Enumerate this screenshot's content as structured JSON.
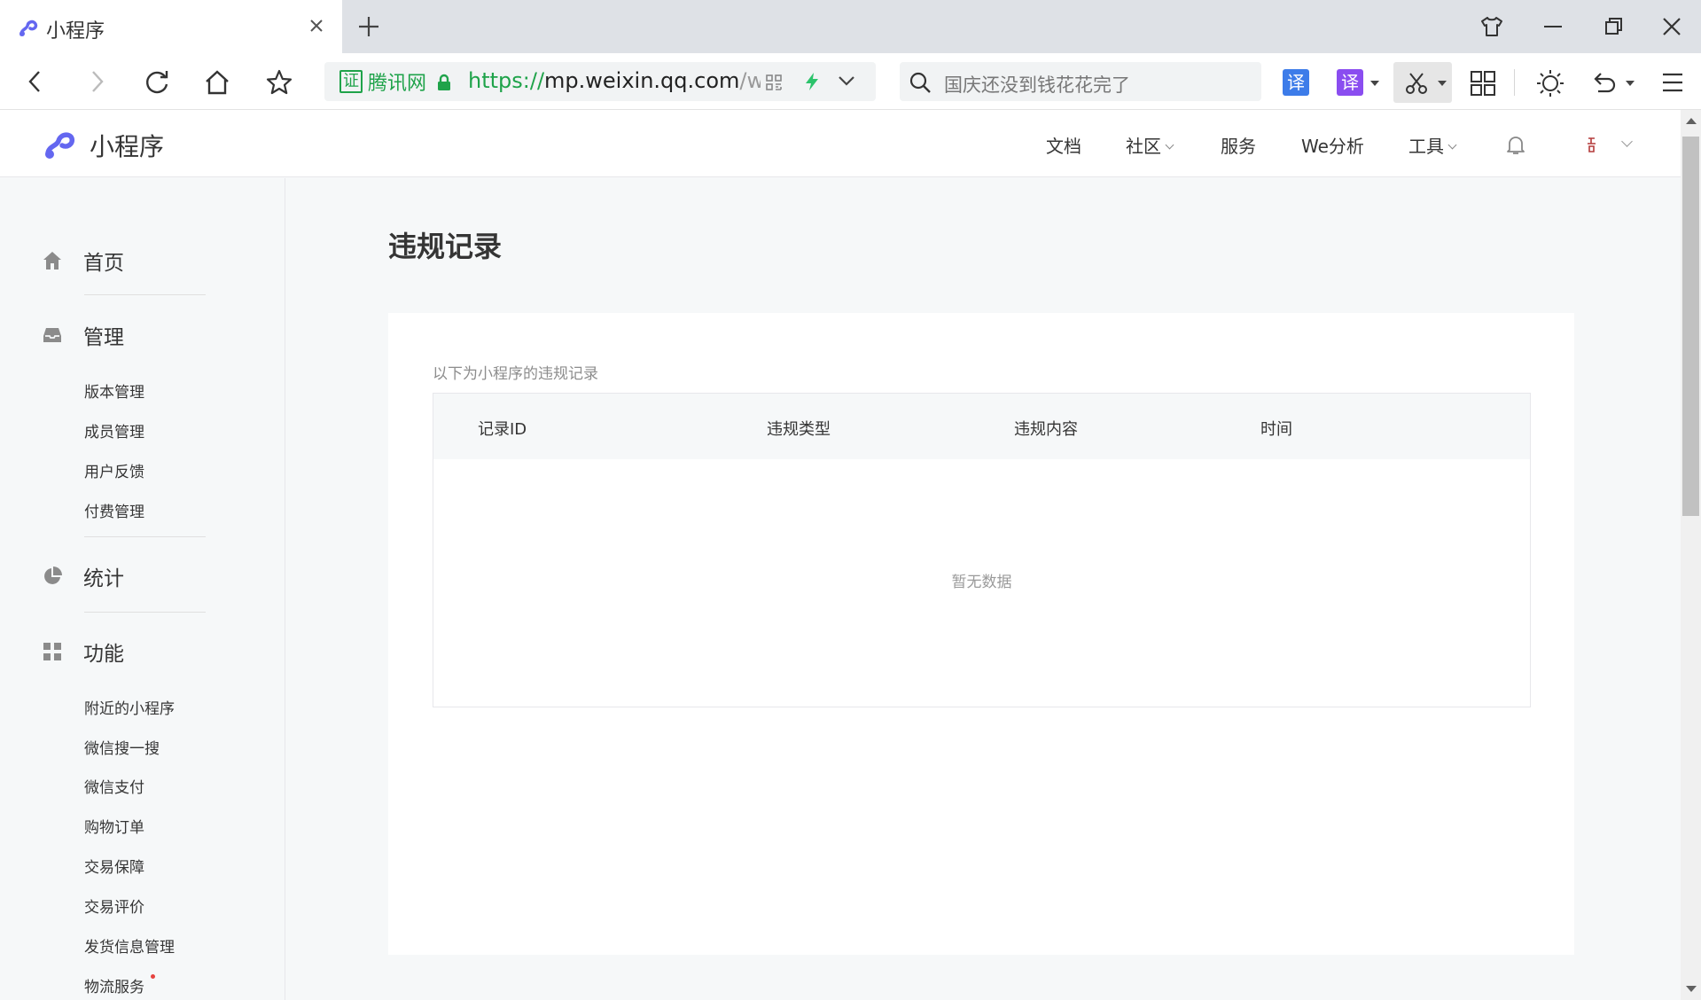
{
  "browser": {
    "tab_title": "小程序",
    "cert_badge": "证",
    "cert_label": "腾讯网",
    "url_protocol": "https://",
    "url_host": "mp.weixin.qq.com",
    "url_path": "/w:",
    "search_text": "国庆还没到钱花花完了",
    "translate_1": "译",
    "translate_2": "译"
  },
  "header": {
    "brand": "小程序",
    "nav": [
      {
        "label": "文档"
      },
      {
        "label": "社区"
      },
      {
        "label": "服务"
      },
      {
        "label": "We分析"
      },
      {
        "label": "工具"
      }
    ]
  },
  "sidebar": {
    "groups": [
      {
        "label": "首页",
        "icon": "home-icon"
      },
      {
        "label": "管理",
        "icon": "inbox-icon",
        "items": [
          "版本管理",
          "成员管理",
          "用户反馈",
          "付费管理"
        ]
      },
      {
        "label": "统计",
        "icon": "pie-chart-icon"
      },
      {
        "label": "功能",
        "icon": "grid-icon",
        "items": [
          "附近的小程序",
          "微信搜一搜",
          "微信支付",
          "购物订单",
          "交易保障",
          "交易评价",
          "发货信息管理",
          "物流服务"
        ]
      }
    ]
  },
  "main": {
    "title": "违规记录",
    "description": "以下为小程序的违规记录",
    "columns": [
      "记录ID",
      "违规类型",
      "违规内容",
      "时间"
    ],
    "empty_text": "暂无数据"
  },
  "colors": {
    "accent_green": "#1fa34a",
    "brand_purple": "#6467f0",
    "notice_red": "#e64340"
  }
}
